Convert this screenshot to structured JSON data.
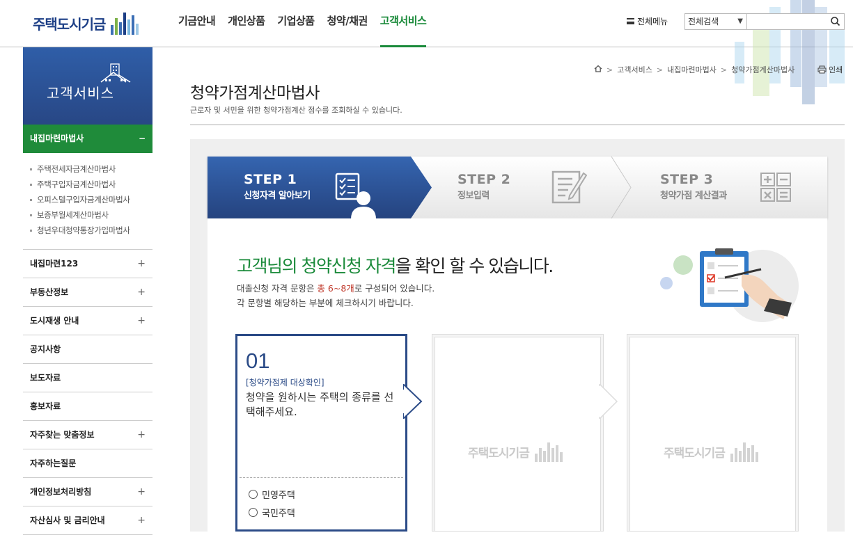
{
  "header": {
    "logo_text": "주택도시기금",
    "nav": [
      "기금안내",
      "개인상품",
      "기업상품",
      "청약/채권",
      "고객서비스"
    ],
    "active_nav": "고객서비스",
    "all_menu": "전체메뉴",
    "search_scope": "전체검색",
    "search_value": ""
  },
  "sidebar": {
    "title": "고객서비스",
    "current": {
      "label": "내집마련마법사",
      "toggle": "−"
    },
    "sub_items": [
      "주택전세자금계산마법사",
      "주택구입자금계산마법사",
      "오피스텔구입자금계산마법사",
      "보증부월세계산마법사",
      "청년우대청약통장가입마법사"
    ],
    "menu": [
      {
        "label": "내집마련123",
        "toggle": "+"
      },
      {
        "label": "부동산정보",
        "toggle": "+"
      },
      {
        "label": "도시재생 안내",
        "toggle": "+"
      },
      {
        "label": "공지사항",
        "toggle": ""
      },
      {
        "label": "보도자료",
        "toggle": ""
      },
      {
        "label": "홍보자료",
        "toggle": ""
      },
      {
        "label": "자주찾는 맞춤정보",
        "toggle": "+"
      },
      {
        "label": "자주하는질문",
        "toggle": ""
      },
      {
        "label": "개인정보처리방침",
        "toggle": "+"
      },
      {
        "label": "자산심사 및 금리안내",
        "toggle": "+"
      }
    ]
  },
  "breadcrumb": [
    "고객서비스",
    "내집마련마법사",
    "청약가점계산마법사"
  ],
  "print_label": "인쇄",
  "page": {
    "title": "청약가점계산마법사",
    "description": "근로자 및 서민을 위한 청약가점계산 점수를 조회하실 수 있습니다."
  },
  "steps": [
    {
      "title": "STEP 1",
      "label": "신청자격 알아보기",
      "active": true
    },
    {
      "title": "STEP 2",
      "label": "정보입력",
      "active": false
    },
    {
      "title": "STEP 3",
      "label": "청약가점 계산결과",
      "active": false
    }
  ],
  "headline": {
    "part1": "고객님의 청약신청 자격",
    "part2": "을 확인 할 수 있습니다."
  },
  "subline1": {
    "before": "대출신청 자격 문항은 ",
    "highlight": "총 6~8개",
    "after": "로 구성되어 있습니다."
  },
  "subline2": "각 문항별 해당하는 부분에 체크하시기 바랍니다.",
  "question": {
    "number": "01",
    "tag": "[청약가점제 대상확인]",
    "text": "청약을 원하시는 주택의 종류를 선택해주세요.",
    "options": [
      "민영주택",
      "국민주택"
    ]
  },
  "placeholder_logo": "주택도시기금",
  "colors": {
    "brand_blue": "#2b4b87",
    "brand_green": "#1a8a3a"
  }
}
